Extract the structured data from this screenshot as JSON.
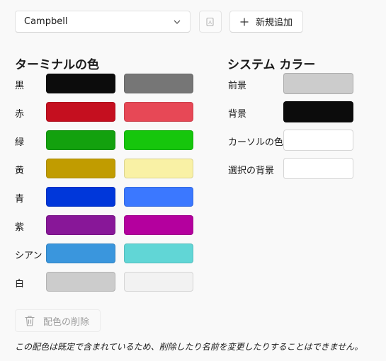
{
  "toolbar": {
    "scheme_value": "Campbell",
    "new_label": "新規追加"
  },
  "terminal_colors": {
    "heading": "ターミナルの色",
    "rows": [
      {
        "label": "黒",
        "normal": "#0c0c0c",
        "bright": "#767676"
      },
      {
        "label": "赤",
        "normal": "#c50f1f",
        "bright": "#e74856"
      },
      {
        "label": "緑",
        "normal": "#13a10e",
        "bright": "#16c60c"
      },
      {
        "label": "黄",
        "normal": "#c19c00",
        "bright": "#f9f1a5"
      },
      {
        "label": "青",
        "normal": "#0037da",
        "bright": "#3b78ff"
      },
      {
        "label": "紫",
        "normal": "#881798",
        "bright": "#b4009e"
      },
      {
        "label": "シアン",
        "normal": "#3a96dd",
        "bright": "#61d6d6"
      },
      {
        "label": "白",
        "normal": "#cccccc",
        "bright": "#f2f2f2"
      }
    ]
  },
  "system_colors": {
    "heading": "システム カラー",
    "rows": [
      {
        "label": "前景",
        "color": "#cccccc"
      },
      {
        "label": "背景",
        "color": "#0c0c0c"
      },
      {
        "label": "カーソルの色",
        "color": "#ffffff"
      },
      {
        "label": "選択の背景",
        "color": "#ffffff"
      }
    ]
  },
  "delete": {
    "label": "配色の削除"
  },
  "note": "この配色は既定で含まれているため、削除したり名前を変更したりすることはできません。",
  "icons": {
    "dropdown": "chevron-down-icon",
    "rename": "rename-icon",
    "add": "plus-icon",
    "delete": "trash-icon"
  }
}
